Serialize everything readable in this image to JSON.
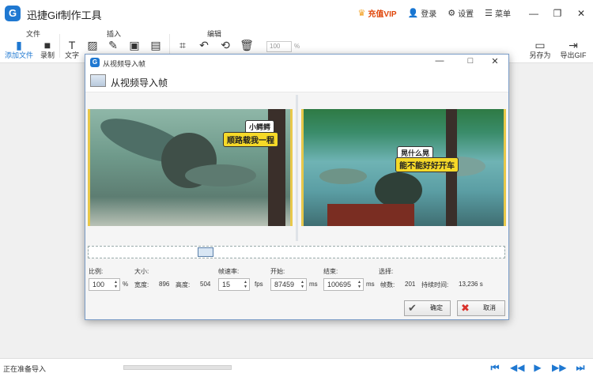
{
  "app": {
    "title": "迅捷Gif制作工具",
    "logo_letter": "G"
  },
  "titlebar": {
    "vip": "充值VIP",
    "login": "登录",
    "settings": "设置",
    "menu": "菜单"
  },
  "toolbar": {
    "groups": {
      "file": "文件",
      "insert": "插入",
      "edit": "编辑"
    },
    "add_file": "添加文件",
    "record": "录制",
    "text": "文字",
    "zoom_value": "100",
    "zoom_unit": "%",
    "save_as": "另存为",
    "export_gif": "导出GIF"
  },
  "status": {
    "text": "正在准备导入"
  },
  "dialog": {
    "window_title": "从视频导入帧",
    "header_title": "从视频导入帧",
    "left_caption_top": "小鳄鳄",
    "left_caption_main": "顺路载我一程",
    "right_caption_top": "晃什么晃",
    "right_caption_main": "能不能好好开车",
    "labels": {
      "scale": "比例:",
      "size": "大小:",
      "fps": "帧速率:",
      "start": "开始:",
      "end": "结束:",
      "select": "选择:"
    },
    "scale_value": "100",
    "scale_unit": "%",
    "width_label": "宽度:",
    "width_value": "896",
    "height_label": "高度:",
    "height_value": "504",
    "fps_value": "15",
    "fps_unit": "fps",
    "start_value": "87459",
    "start_unit": "ms",
    "end_value": "100695",
    "end_unit": "ms",
    "frames_label": "帧数:",
    "frames_value": "201",
    "duration_label": "持续时间:",
    "duration_value": "13,236 s",
    "ok": "确定",
    "cancel": "取消"
  },
  "colors": {
    "accent": "#1f78d1",
    "vip": "#e0460a",
    "caption": "#f6d928"
  }
}
